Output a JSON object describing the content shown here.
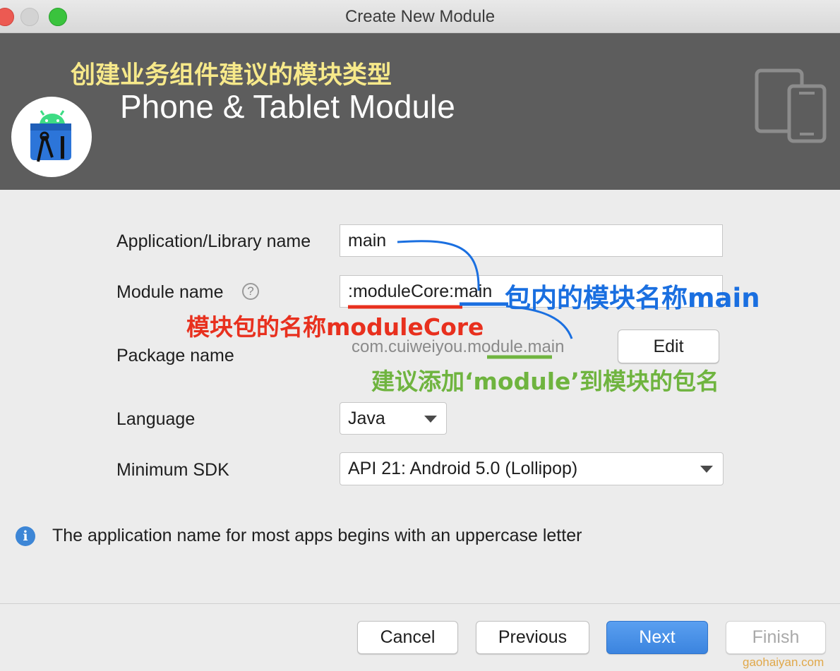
{
  "window": {
    "title": "Create New Module"
  },
  "header": {
    "annotation": "创建业务组件建议的模块类型",
    "module_type": "Phone & Tablet Module"
  },
  "form": {
    "app_name": {
      "label": "Application/Library name",
      "value": "main"
    },
    "module_name": {
      "label": "Module name",
      "value": ":moduleCore:main",
      "help": "?"
    },
    "package_name": {
      "label": "Package name",
      "value": "com.cuiweiyou.module.main",
      "edit_label": "Edit"
    },
    "language": {
      "label": "Language",
      "value": "Java"
    },
    "min_sdk": {
      "label": "Minimum SDK",
      "value": "API 21: Android 5.0 (Lollipop)"
    }
  },
  "annotations": {
    "module_inner_name": "包内的模块名称main",
    "module_package_name": "模块包的名称moduleCore",
    "package_suggestion": "建议添加‘module’到模块的包名"
  },
  "info": {
    "icon": "i",
    "text": "The application name for most apps begins with an uppercase letter"
  },
  "footer": {
    "cancel": "Cancel",
    "previous": "Previous",
    "next": "Next",
    "finish": "Finish"
  },
  "watermark": "gaohaiyan.com",
  "colors": {
    "header_bg": "#5d5d5d",
    "annotation_yellow": "#f7e98a",
    "annotation_blue": "#1a6fe0",
    "annotation_red": "#e8301e",
    "annotation_green": "#6fb43f",
    "primary_button": "#3b84df"
  },
  "icons": [
    "android-studio-logo-icon",
    "phone-tablet-icon",
    "help-icon",
    "info-icon",
    "dropdown-caret-icon"
  ]
}
